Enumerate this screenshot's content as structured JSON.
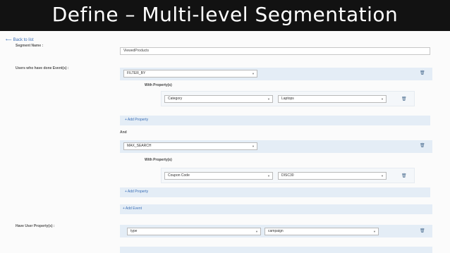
{
  "slide": {
    "title": "Define – Multi-level Segmentation"
  },
  "page": {
    "back_label": "Back to list",
    "back_arrow": "⟵",
    "segment_name_label": "Segment Name :",
    "segment_name_value": "ViewedProducts",
    "events_label": "Users who have done Event(s) :",
    "and_label": "And",
    "with_property_label": "With Property(s)",
    "add_property_label": "Add Property",
    "add_event_label": "Add Event",
    "user_property_label": "Have User Property(s) :",
    "plus_icon": "+",
    "caret_icon": "▼",
    "trash_icon": "🗑",
    "events": [
      {
        "name": "FILTER_BY",
        "property": {
          "key": "Category",
          "value": "Laptops"
        }
      },
      {
        "name": "MAX_SEARCH",
        "property": {
          "key": "Coupon Code",
          "value": "DISC30"
        }
      }
    ],
    "user_property": {
      "key": "type",
      "value": "campaign"
    }
  },
  "colors": {
    "banner": "#121212",
    "panel": "#e4edf6",
    "link": "#3b6fb6"
  }
}
